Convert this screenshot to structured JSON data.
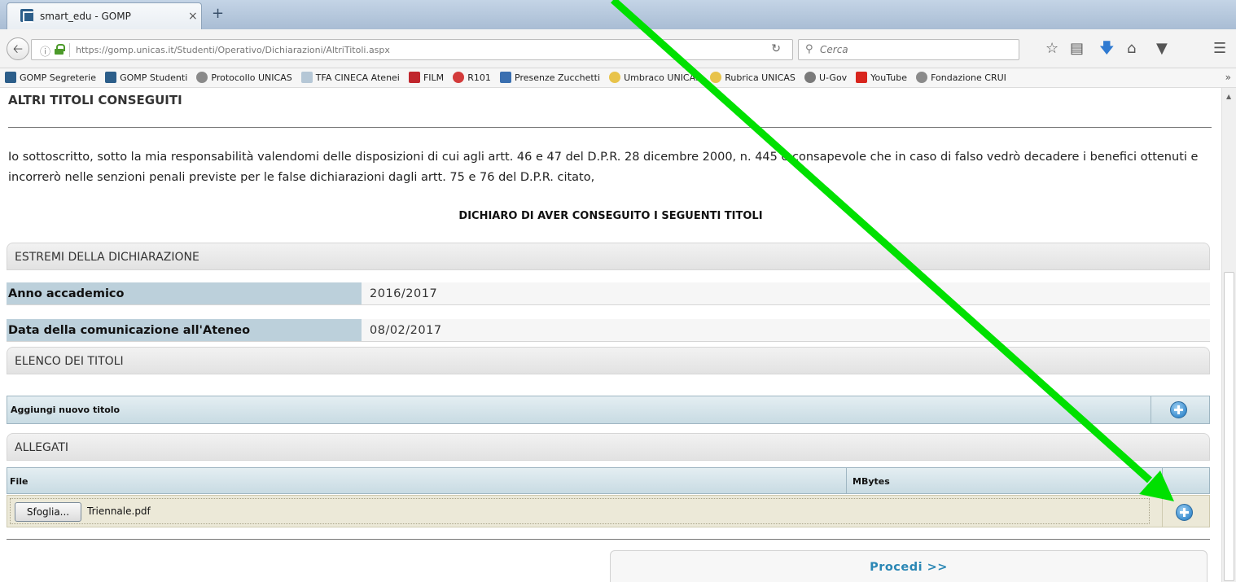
{
  "browser": {
    "tab_title": "smart_edu - GOMP",
    "tab_close": "×",
    "new_tab": "+",
    "url": "https://gomp.unicas.it/Studenti/Operativo/Dichiarazioni/AltriTitoli.aspx",
    "search_placeholder": "Cerca",
    "back_icon": "arrow-left-icon",
    "nav_icons": [
      "star-icon",
      "reading-list-icon",
      "download-icon",
      "home-icon",
      "pocket-icon",
      "menu-icon"
    ]
  },
  "bookmarks": [
    {
      "label": "GOMP Segreterie",
      "color": "#2c5e8a"
    },
    {
      "label": "GOMP Studenti",
      "color": "#2c5e8a"
    },
    {
      "label": "Protocollo UNICAS",
      "color": "#8a8a8a"
    },
    {
      "label": "TFA CINECA Atenei",
      "color": "#b5c7d6"
    },
    {
      "label": "FILM",
      "color": "#c0262d"
    },
    {
      "label": "R101",
      "color": "#d33b3b"
    },
    {
      "label": "Presenze Zucchetti",
      "color": "#3a6fb0"
    },
    {
      "label": "Umbraco UNICAS",
      "color": "#e8c34a"
    },
    {
      "label": "Rubrica UNICAS",
      "color": "#e8c34a"
    },
    {
      "label": "U-Gov",
      "color": "#7a7a7a"
    },
    {
      "label": "YouTube",
      "color": "#d8251d"
    },
    {
      "label": "Fondazione CRUI",
      "color": "#8a8a8a"
    }
  ],
  "page": {
    "section_title": "ALTRI TITOLI CONSEGUITI",
    "declaration": "Io sottoscritto, sotto la mia responsabilità valendomi delle disposizioni di cui agli artt. 46 e 47 del D.P.R. 28 dicembre 2000, n. 445 e consapevole che in caso di falso vedrò decadere i benefici ottenuti e incorrerò nelle senzioni penali previste per le false dichiarazioni dagli artt. 75 e 76 del D.P.R. citato,",
    "declaro": "DICHIARO DI AVER CONSEGUITO I SEGUENTI TITOLI",
    "estremi_header": "ESTREMI DELLA DICHIARAZIONE",
    "anno_label": "Anno accademico",
    "anno_value": "2016/2017",
    "data_label": "Data della comunicazione all'Ateneo",
    "data_value": "08/02/2017",
    "elenco_header": "ELENCO DEI TITOLI",
    "add_title_label": "Aggiungi nuovo titolo",
    "allegati_header": "ALLEGATI",
    "col_file": "File",
    "col_mbytes": "MBytes",
    "browse_label": "Sfoglia...",
    "file_name": "Triennale.pdf",
    "proceed_label": "Procedi >>"
  },
  "annotation": {
    "arrow_color": "#00e000"
  }
}
